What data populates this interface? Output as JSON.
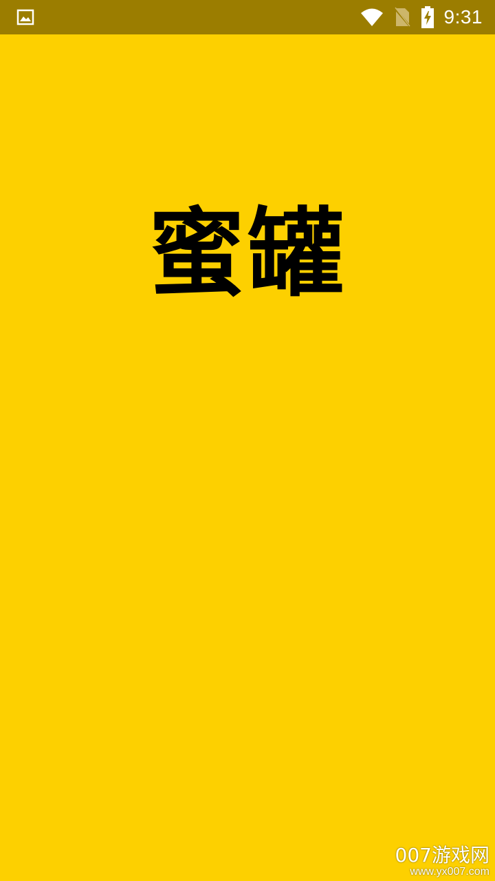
{
  "status_bar": {
    "time": "9:31",
    "icons": {
      "left": "image-notification-icon",
      "wifi": "wifi-icon",
      "sim": "no-sim-icon",
      "battery": "battery-charging-icon"
    }
  },
  "splash": {
    "logo_text": "蜜罐",
    "background_color": "#FDD000",
    "logo_color": "#000000"
  },
  "watermark": {
    "main": "007游戏网",
    "sub": "www.yx007.com"
  }
}
